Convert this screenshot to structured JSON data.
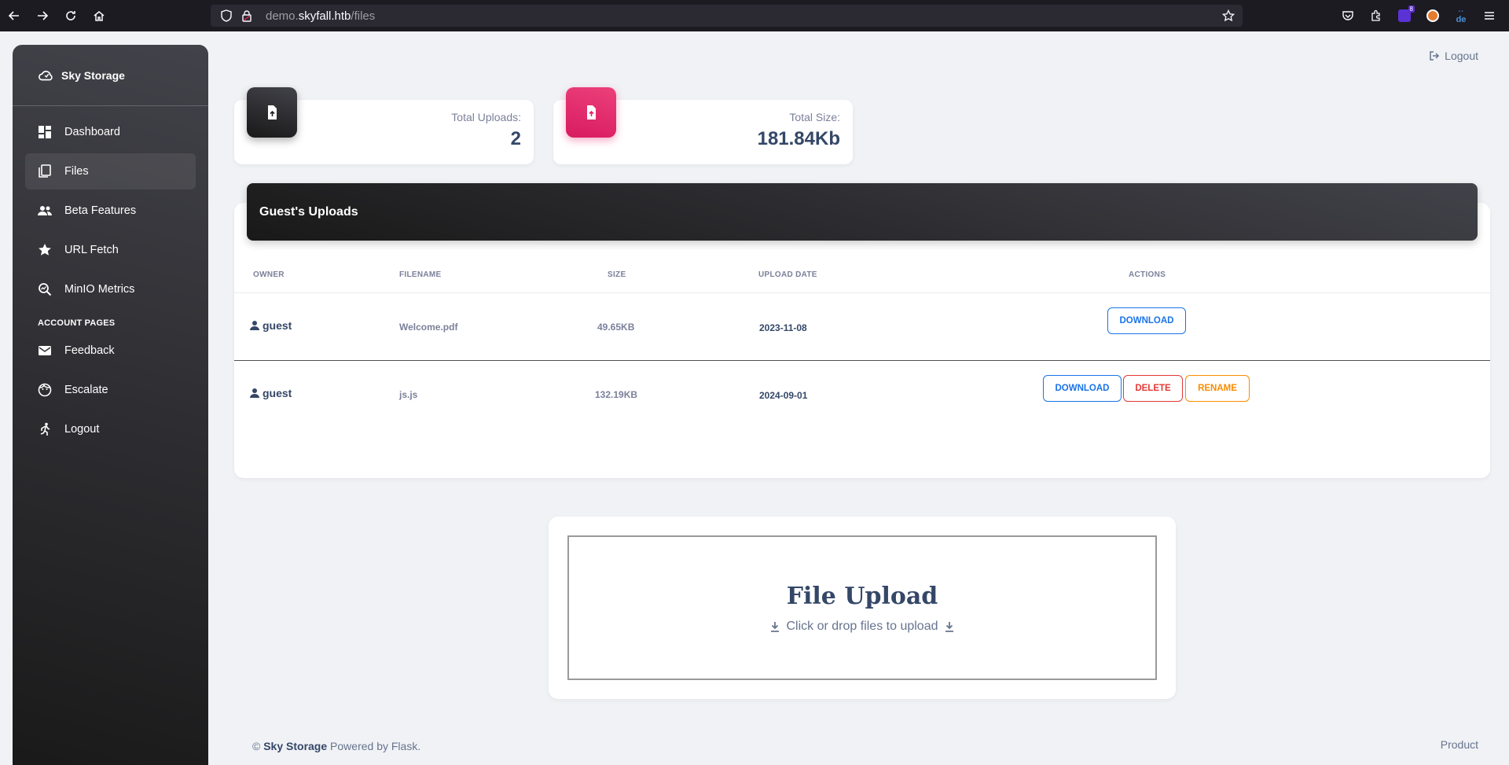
{
  "browser": {
    "url_prefix": "demo.",
    "url_domain": "skyfall.htb",
    "url_path": "/files",
    "ext_badge": "8",
    "ext_text": "de"
  },
  "sidebar": {
    "brand": "Sky Storage",
    "items": [
      {
        "label": "Dashboard",
        "icon": "dashboard-icon"
      },
      {
        "label": "Files",
        "icon": "files-icon"
      },
      {
        "label": "Beta Features",
        "icon": "people-icon"
      },
      {
        "label": "URL Fetch",
        "icon": "star-icon"
      },
      {
        "label": "MinIO Metrics",
        "icon": "query-stats-icon"
      }
    ],
    "section_title": "ACCOUNT PAGES",
    "account_items": [
      {
        "label": "Feedback",
        "icon": "mail-icon"
      },
      {
        "label": "Escalate",
        "icon": "face-icon"
      },
      {
        "label": "Logout",
        "icon": "run-icon"
      }
    ]
  },
  "header": {
    "logout_label": "Logout"
  },
  "stats": {
    "uploads_label": "Total Uploads:",
    "uploads_value": "2",
    "size_label": "Total Size:",
    "size_value": "181.84Kb",
    "uploads_color": "#191919",
    "size_color": "#e91e63"
  },
  "table": {
    "title": "Guest's Uploads",
    "columns": [
      "OWNER",
      "FILENAME",
      "SIZE",
      "UPLOAD DATE",
      "ACTIONS"
    ],
    "rows": [
      {
        "owner": "guest",
        "filename": "Welcome.pdf",
        "size": "49.65KB",
        "date": "2023-11-08",
        "actions": [
          "DOWNLOAD"
        ]
      },
      {
        "owner": "guest",
        "filename": "js.js",
        "size": "132.19KB",
        "date": "2024-09-01",
        "actions": [
          "DOWNLOAD",
          "DELETE",
          "RENAME"
        ]
      }
    ]
  },
  "upload": {
    "title": "File Upload",
    "subtitle": "Click or drop files to upload"
  },
  "footer": {
    "copyright": "©",
    "brand": "Sky Storage",
    "powered": "Powered by Flask.",
    "right_link": "Product"
  }
}
